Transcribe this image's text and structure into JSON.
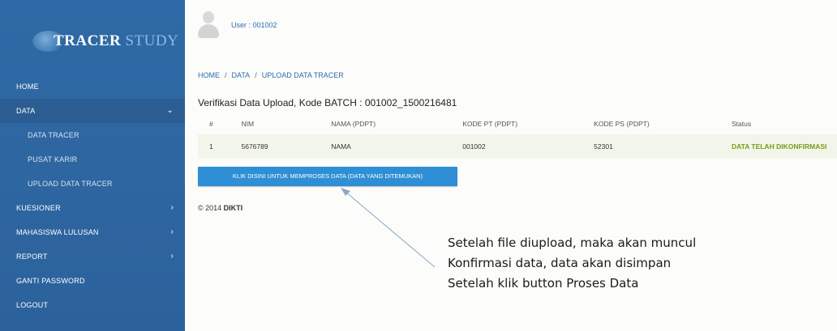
{
  "logo": {
    "text_bold": "TRACER",
    "text_light": "STUDY"
  },
  "sidebar": {
    "items": [
      {
        "label": "HOME"
      },
      {
        "label": "DATA"
      },
      {
        "label": "DATA TRACER"
      },
      {
        "label": "PUSAT KARIR"
      },
      {
        "label": "UPLOAD DATA TRACER"
      },
      {
        "label": "KUESIONER"
      },
      {
        "label": "MAHASISWA LULUSAN"
      },
      {
        "label": "REPORT"
      },
      {
        "label": "GANTI PASSWORD"
      },
      {
        "label": "LOGOUT"
      }
    ],
    "chevron_down": "⌄",
    "chevron_right": "›"
  },
  "header": {
    "user_label": "User : 001002"
  },
  "breadcrumb": {
    "items": [
      "HOME",
      "DATA",
      "UPLOAD DATA TRACER"
    ],
    "separator": "/"
  },
  "main": {
    "title": "Verifikasi Data Upload, Kode BATCH : 001002_1500216481",
    "table": {
      "headers": [
        "#",
        "NIM",
        "NAMA (PDPT)",
        "KODE PT (PDPT)",
        "KODE PS (PDPT)",
        "Status"
      ],
      "rows": [
        [
          "1",
          "5676789",
          "NAMA",
          "001002",
          "52301",
          "DATA TELAH DIKONFIRMASI"
        ]
      ]
    },
    "process_button": "KLIK DISINI UNTUK MEMPROSES DATA (DATA YANG DITEMUKAN)"
  },
  "footer": {
    "copyright": "© 2014",
    "brand": "DIKTI"
  },
  "annotation": {
    "lines": [
      "Setelah file diupload, maka akan muncul",
      "Konfirmasi data, data akan disimpan",
      "Setelah klik button Proses Data"
    ]
  },
  "colors": {
    "sidebar": "#2f6aa6",
    "accent": "#2f8fd6",
    "status_ok": "#7a9a1c",
    "link": "#2c6cb2"
  }
}
